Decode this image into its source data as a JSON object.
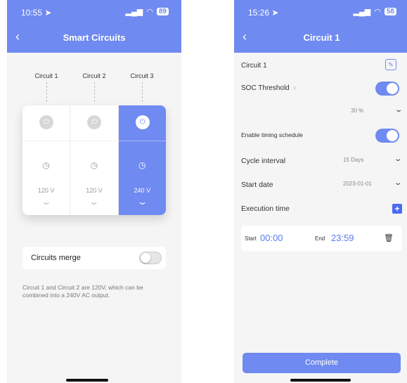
{
  "colors": {
    "accent": "#6f8af0",
    "background": "#f5f5f5"
  },
  "left_screen": {
    "status": {
      "time": "10:55",
      "battery": "89",
      "signal": "signal-icon",
      "wifi": "wifi-icon"
    },
    "title": "Smart Circuits",
    "circuits": [
      {
        "label": "Circuit 1",
        "voltage": "120 V",
        "active": false
      },
      {
        "label": "Circuit 2",
        "voltage": "120 V",
        "active": false
      },
      {
        "label": "Circuit 3",
        "voltage": "240 V",
        "active": true
      }
    ],
    "merge": {
      "label": "Circuits merge",
      "enabled": false
    },
    "description": "Circuit 1 and Circuit 2 are 120V, which can be combined into a 240V AC output."
  },
  "right_screen": {
    "status": {
      "time": "15:26",
      "battery": "58"
    },
    "title": "Circuit  1",
    "circuit_name": "Circuit  1",
    "soc_label": "SOC Threshold",
    "soc_value": "30 %",
    "timing_label": "Enable timing schedule",
    "cycle_label": "Cycle interval",
    "cycle_value": "15 Days",
    "start_label": "Start date",
    "start_value": "2023-01-01",
    "exec_label": "Execution time",
    "start_key": "Start",
    "start_time": "00:00",
    "end_key": "End",
    "end_time": "23:59",
    "complete": "Complete"
  }
}
